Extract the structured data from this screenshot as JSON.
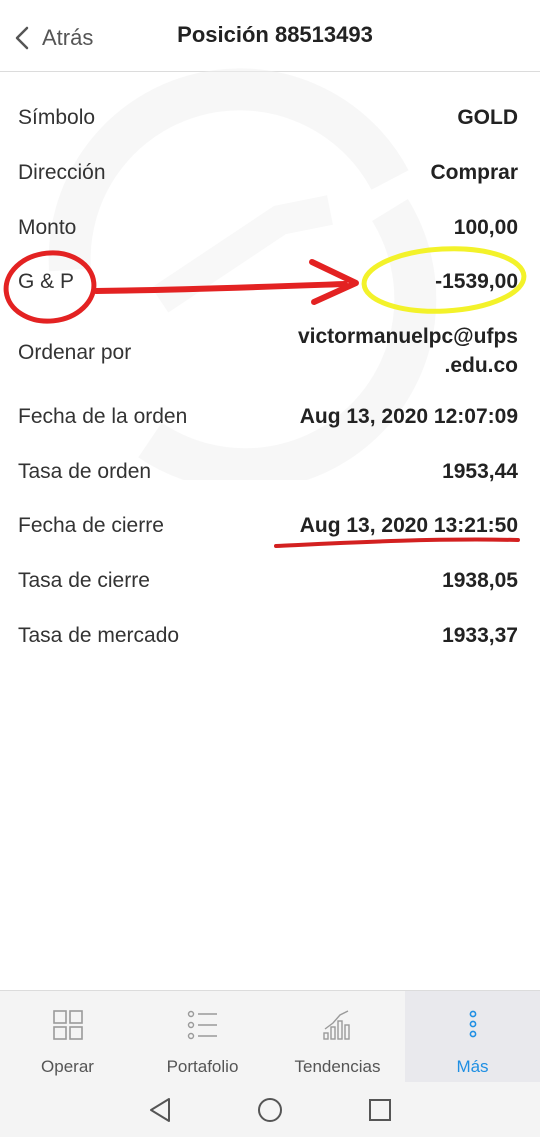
{
  "header": {
    "back_label": "Atrás",
    "title": "Posición 88513493"
  },
  "details": [
    {
      "label": "Símbolo",
      "value": "GOLD"
    },
    {
      "label": "Dirección",
      "value": "Comprar"
    },
    {
      "label": "Monto",
      "value": "100,00"
    },
    {
      "label": "G & P",
      "value": "-1539,00"
    },
    {
      "label": "Ordenar por",
      "value_line1": "victormanuelpc@ufps",
      "value_line2": ".edu.co"
    },
    {
      "label": "Fecha de la orden",
      "value": "Aug 13, 2020 12:07:09"
    },
    {
      "label": "Tasa de orden",
      "value": "1953,44"
    },
    {
      "label": "Fecha de cierre",
      "value": "Aug 13, 2020 13:21:50"
    },
    {
      "label": "Tasa de cierre",
      "value": "1938,05"
    },
    {
      "label": "Tasa de mercado",
      "value": "1933,37"
    }
  ],
  "bottom_nav": [
    {
      "label": "Operar",
      "icon": "grid-icon"
    },
    {
      "label": "Portafolio",
      "icon": "list-icon"
    },
    {
      "label": "Tendencias",
      "icon": "bar-chart-icon"
    },
    {
      "label": "Más",
      "icon": "more-dots-icon",
      "active": true
    }
  ],
  "system_nav": [
    "back-triangle-icon",
    "home-circle-icon",
    "recents-square-icon"
  ],
  "colors": {
    "active_tab": "#1f8fe3",
    "annotation_red": "#e32222",
    "annotation_yellow": "#f3f22a"
  }
}
